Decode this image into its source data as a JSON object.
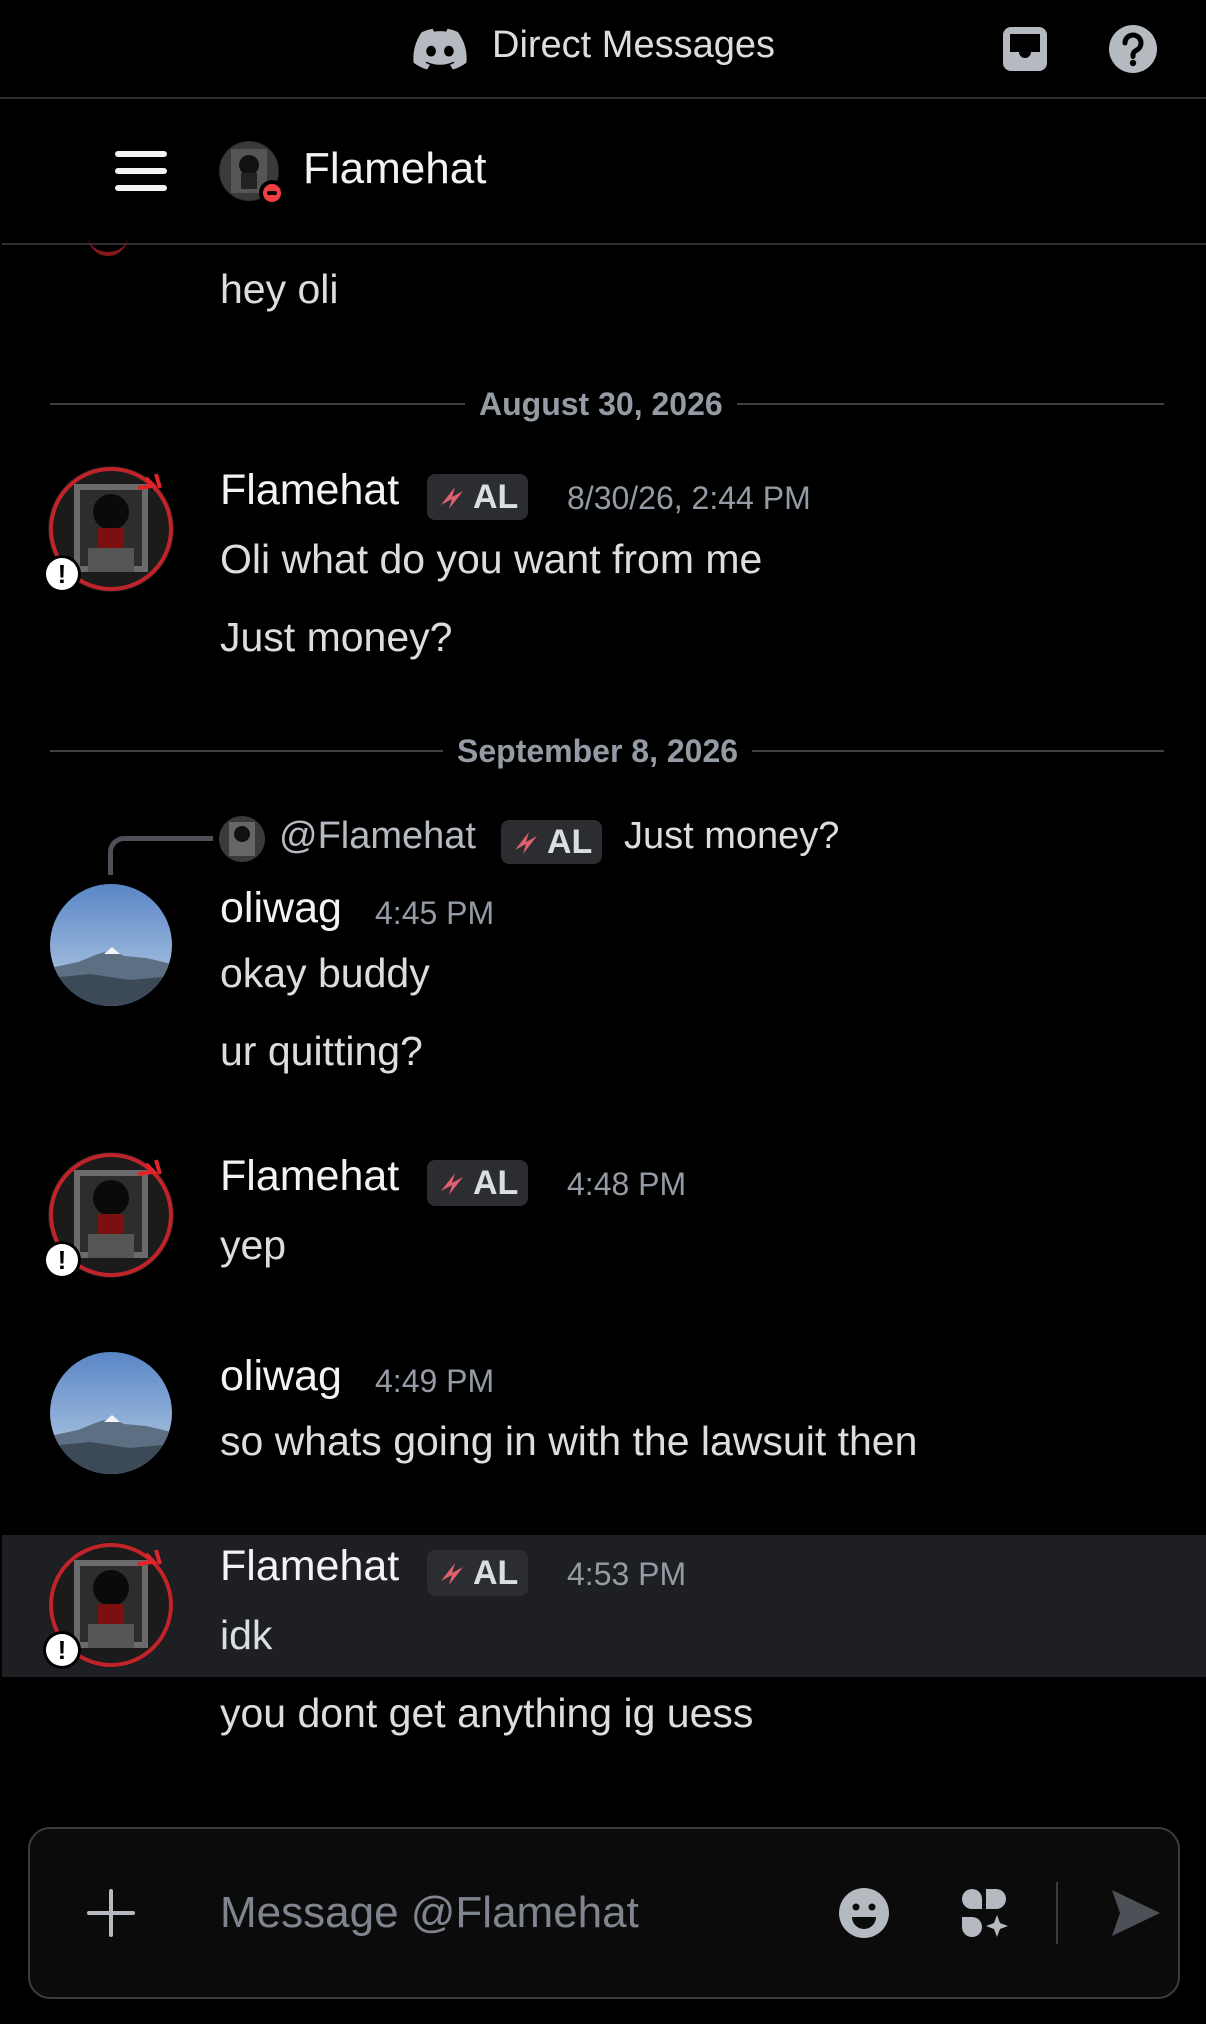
{
  "topbar": {
    "title": "Direct Messages"
  },
  "channel": {
    "name": "Flamehat"
  },
  "dividers": [
    "August 30, 2026",
    "September 8, 2026"
  ],
  "tag_label": "AL",
  "messages": {
    "m0": {
      "text": "hey oli"
    },
    "m1": {
      "author": "Flamehat",
      "time": "8/30/26, 2:44 PM",
      "line1": "Oli what do you want from me",
      "line2": "Just money?"
    },
    "m2": {
      "reply_author": "@Flamehat",
      "reply_text": "Just money?",
      "author": "oliwag",
      "time": "4:45 PM",
      "line1": "okay buddy",
      "line2": "ur quitting?"
    },
    "m3": {
      "author": "Flamehat",
      "time": "4:48 PM",
      "line1": "yep"
    },
    "m4": {
      "author": "oliwag",
      "time": "4:49 PM",
      "line1": "so whats going in with the lawsuit then"
    },
    "m5": {
      "author": "Flamehat",
      "time": "4:53 PM",
      "line1": "idk",
      "line2": "you dont get anything ig uess"
    }
  },
  "composer": {
    "placeholder": "Message @Flamehat"
  },
  "colors": {
    "background": "#000000",
    "status_dnd": "#f23f43",
    "highlight": "#1e1f22",
    "tag_bg": "#2b2d31"
  }
}
